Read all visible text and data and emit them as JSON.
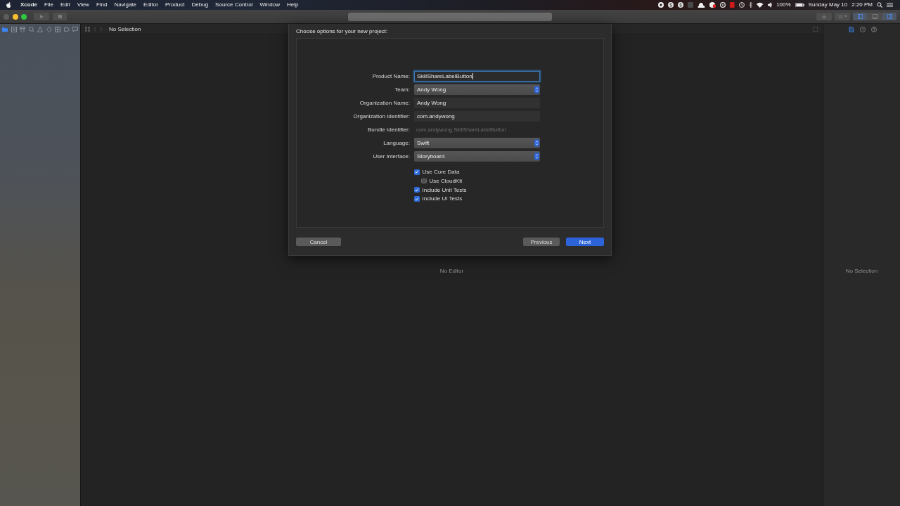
{
  "menu_bar": {
    "app_name": "Xcode",
    "menus": [
      "File",
      "Edit",
      "View",
      "Find",
      "Navigate",
      "Editor",
      "Product",
      "Debug",
      "Source Control",
      "Window",
      "Help"
    ],
    "battery": "100%",
    "date": "Sunday May 10",
    "time": "2:20 PM"
  },
  "toolbar": {
    "panel_toggles": [
      {
        "on": true
      },
      {
        "on": false
      },
      {
        "on": true
      }
    ]
  },
  "navigator": {
    "tabs": [
      {
        "selected": true
      },
      {
        "selected": false
      },
      {
        "selected": false
      },
      {
        "selected": false
      },
      {
        "selected": false
      },
      {
        "selected": false
      },
      {
        "selected": false
      },
      {
        "selected": false
      },
      {
        "selected": false
      }
    ]
  },
  "jump_bar": {
    "label": "No Selection"
  },
  "editor": {
    "message": "No Editor"
  },
  "inspector": {
    "tabs": [
      {
        "selected": true
      },
      {
        "selected": false
      },
      {
        "selected": false
      }
    ],
    "message": "No Selection"
  },
  "dialog": {
    "title": "Choose options for your new project:",
    "fields": [
      {
        "label": "Product Name:",
        "kind": "text",
        "value": "SkillShareLabelButton",
        "focused": true
      },
      {
        "label": "Team:",
        "kind": "popup",
        "value": "Andy Wong",
        "focused": false
      },
      {
        "label": "Organization Name:",
        "kind": "text",
        "value": "Andy Wong",
        "focused": false
      },
      {
        "label": "Organization Identifier:",
        "kind": "text",
        "value": "com.andywong",
        "focused": false
      },
      {
        "label": "Bundle Identifier:",
        "kind": "static",
        "value": "com.andywong.SkillShareLabelButton",
        "focused": false
      },
      {
        "label": "Language:",
        "kind": "popup",
        "value": "Swift",
        "focused": false
      },
      {
        "label": "User Interface:",
        "kind": "popup",
        "value": "Storyboard",
        "focused": false
      }
    ],
    "options": [
      {
        "label": "Use Core Data",
        "checked": true,
        "children": [
          {
            "label": "Use CloudKit",
            "checked": false
          }
        ]
      },
      {
        "label": "Include Unit Tests",
        "checked": true
      },
      {
        "label": "Include UI Tests",
        "checked": true
      }
    ],
    "cancel_button": {
      "label": "Cancel"
    },
    "nav_buttons": [
      {
        "label": "Previous",
        "primary": false
      },
      {
        "label": "Next",
        "primary": true
      }
    ]
  }
}
